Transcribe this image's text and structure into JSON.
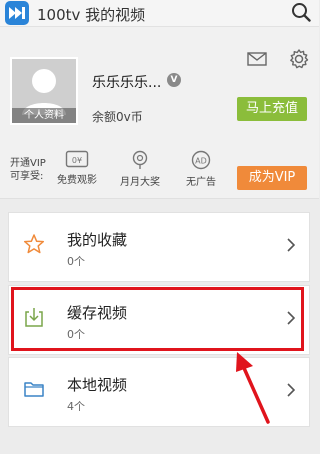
{
  "app": {
    "title": "100tv 我的视频",
    "logo_icon": "play-forward-icon",
    "search_icon": "search-icon"
  },
  "profile": {
    "avatar_caption": "个人资料",
    "username": "乐乐乐乐...",
    "vip_badge": "V",
    "balance": "余额0v币",
    "recharge_label": "马上充值",
    "recharge_color": "#8bbd3b"
  },
  "vip": {
    "label": "开通VIP可享受:",
    "perks": [
      {
        "icon": "ticket-icon",
        "label": "免费观影"
      },
      {
        "icon": "medal-icon",
        "label": "月月大奖"
      },
      {
        "icon": "no-ad-icon",
        "label": "无广告"
      }
    ],
    "button_label": "成为VIP",
    "button_color": "#f08a3a"
  },
  "menu": [
    {
      "icon": "star-icon",
      "title": "我的收藏",
      "count": "0个"
    },
    {
      "icon": "download-icon",
      "title": "缓存视频",
      "count": "0个"
    },
    {
      "icon": "folder-icon",
      "title": "本地视频",
      "count": "4个"
    }
  ],
  "annotation": {
    "highlight_color": "#e0141c"
  }
}
